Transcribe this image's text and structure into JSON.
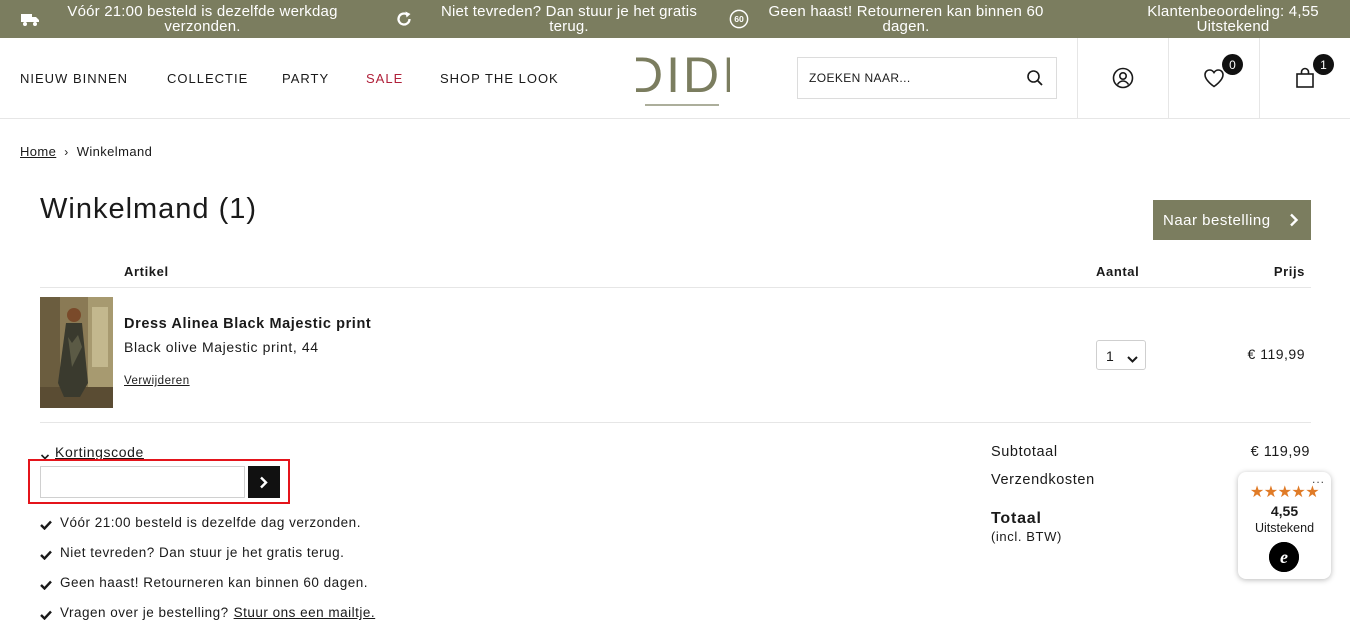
{
  "topbar": {
    "items": [
      {
        "icon": "truck-icon",
        "text": "Vóór 21:00 besteld is dezelfde werkdag verzonden."
      },
      {
        "icon": "refresh-icon",
        "text": "Niet tevreden? Dan stuur je het gratis terug."
      },
      {
        "icon": "60-days-icon",
        "icon_text": "60",
        "text": "Geen haast! Retourneren kan binnen 60 dagen."
      },
      {
        "icon": "",
        "text": "Klantenbeoordeling: 4,55 Uitstekend"
      }
    ]
  },
  "header": {
    "nav": [
      "NIEUW BINNEN",
      "COLLECTIE",
      "PARTY",
      "SALE",
      "SHOP THE LOOK"
    ],
    "logo_text": "DIDI",
    "search_placeholder": "ZOEKEN NAAR...",
    "wishlist_count": "0",
    "cart_count": "1"
  },
  "breadcrumb": {
    "home": "Home",
    "current": "Winkelmand"
  },
  "page": {
    "title": "Winkelmand (1)",
    "order_button": "Naar bestelling"
  },
  "table": {
    "headers": {
      "article": "Artikel",
      "quantity": "Aantal",
      "price": "Prijs"
    },
    "rows": [
      {
        "name": "Dress Alinea Black Majestic print",
        "variant": "Black olive Majestic print, 44",
        "remove": "Verwijderen",
        "quantity": "1",
        "price": "€ 119,99"
      }
    ]
  },
  "discount": {
    "toggle_label": "Kortingscode",
    "input_value": ""
  },
  "usps": [
    {
      "text": "Vóór 21:00 besteld is dezelfde dag verzonden."
    },
    {
      "text": "Niet tevreden? Dan stuur je het gratis terug."
    },
    {
      "text": "Geen haast! Retourneren kan binnen 60 dagen."
    },
    {
      "text": "Vragen over je bestelling?",
      "link": "Stuur ons een mailtje."
    }
  ],
  "totals": {
    "subtotal_label": "Subtotaal",
    "subtotal_value": "€ 119,99",
    "shipping_label": "Verzendkosten",
    "total_label": "Totaal",
    "total_sub": "(incl. BTW)"
  },
  "trusted_widget": {
    "stars": "★★★★★",
    "score": "4,55",
    "label": "Uitstekend",
    "menu": "..."
  },
  "colors": {
    "brand": "#7b7d5f",
    "sale": "#b0203a",
    "highlight": "#e4141b",
    "stars": "#e07b27"
  }
}
